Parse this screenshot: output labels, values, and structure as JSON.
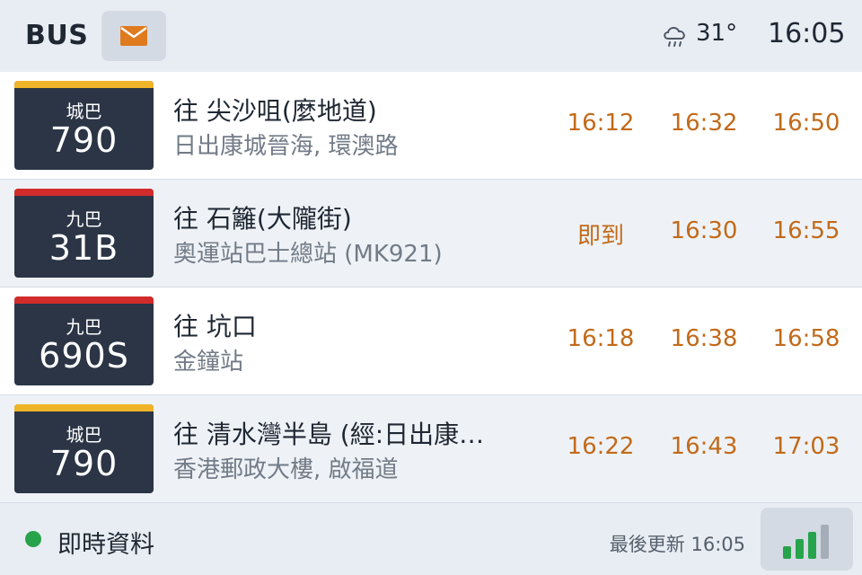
{
  "header": {
    "app_title": "BUS",
    "mail_icon": "envelope-icon",
    "weather_icon": "cloud-rain-icon",
    "temperature": "31°",
    "time": "16:05"
  },
  "colors": {
    "citybus_stripe": "#f0b428",
    "kmb_stripe": "#d22b2b",
    "eta": "#c26a1a",
    "live": "#27a34b",
    "signal_on": "#27a34b",
    "signal_off": "#a5adb8"
  },
  "routes": [
    {
      "operator": "城巴",
      "route": "790",
      "destination": "往 尖沙咀(麼地道)",
      "stop": "日出康城晉海, 環澳路",
      "etas": [
        "16:12",
        "16:32",
        "16:50"
      ]
    },
    {
      "operator": "九巴",
      "route": "31B",
      "destination": "往 石籬(大隴街)",
      "stop": "奧運站巴士總站 (MK921)",
      "etas": [
        "即到",
        "16:30",
        "16:55"
      ]
    },
    {
      "operator": "九巴",
      "route": "690S",
      "destination": "往 坑口",
      "stop": "金鐘站",
      "etas": [
        "16:18",
        "16:38",
        "16:58"
      ]
    },
    {
      "operator": "城巴",
      "route": "790",
      "destination": "往 清水灣半島 (經:日出康…",
      "stop": "香港郵政大樓, 啟福道",
      "etas": [
        "16:22",
        "16:43",
        "17:03"
      ]
    }
  ],
  "footer": {
    "live_label": "即時資料",
    "last_updated": "最後更新 16:05",
    "signal_icon": "signal-strength-icon",
    "signal_bars_active": 3,
    "signal_bars_total": 4
  }
}
